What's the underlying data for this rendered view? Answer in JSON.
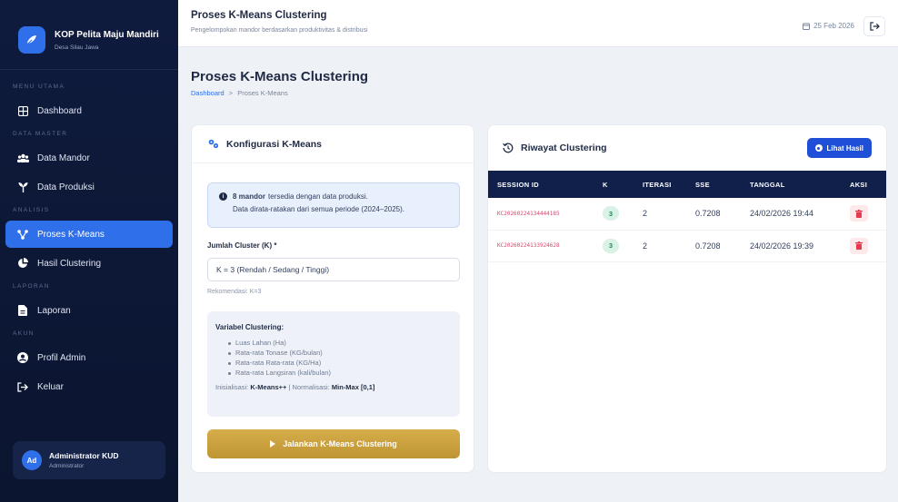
{
  "brand": {
    "title": "KOP Pelita Maju Mandiri",
    "subtitle": "Desa Silau Jawa"
  },
  "sidebar": {
    "sections": [
      {
        "label": "MENU UTAMA",
        "items": [
          {
            "label": "Dashboard",
            "icon": "grid-icon",
            "active": false
          }
        ]
      },
      {
        "label": "DATA MASTER",
        "items": [
          {
            "label": "Data Mandor",
            "icon": "users-icon",
            "active": false
          },
          {
            "label": "Data Produksi",
            "icon": "plant-icon",
            "active": false
          }
        ]
      },
      {
        "label": "ANALISIS",
        "items": [
          {
            "label": "Proses K-Means",
            "icon": "network-icon",
            "active": true
          },
          {
            "label": "Hasil Clustering",
            "icon": "pie-chart-icon",
            "active": false
          }
        ]
      },
      {
        "label": "LAPORAN",
        "items": [
          {
            "label": "Laporan",
            "icon": "file-icon",
            "active": false
          }
        ]
      },
      {
        "label": "AKUN",
        "items": [
          {
            "label": "Profil Admin",
            "icon": "user-circle-icon",
            "active": false
          },
          {
            "label": "Keluar",
            "icon": "logout-icon",
            "active": false
          }
        ]
      }
    ]
  },
  "user": {
    "name": "Administrator KUD",
    "role": "Administrator",
    "initials": "Ad"
  },
  "topbar": {
    "title": "Proses K-Means Clustering",
    "subtitle": "Pengelompokan mandor berdasarkan produktivitas & distribusi",
    "date": "25 Feb 2026"
  },
  "page": {
    "title": "Proses K-Means Clustering",
    "breadcrumb_root": "Dashboard",
    "breadcrumb_sep": ">",
    "breadcrumb_current": "Proses K-Means"
  },
  "config": {
    "title": "Konfigurasi K-Means",
    "info_count": "8 mandor",
    "info_text1": "tersedia dengan data produksi.",
    "info_text2": "Data dirata-ratakan dari semua periode (2024–2025).",
    "field_label": "Jumlah Cluster (K) *",
    "select_value": "K = 3 (Rendah / Sedang / Tinggi)",
    "recommendation": "Rekomendasi: K=3",
    "variables_title": "Variabel Clustering:",
    "variables": [
      "Luas Lahan (Ha)",
      "Rata-rata Tonase (KG/bulan)",
      "Rata-rata Rata-rata (KG/Ha)",
      "Rata-rata Langsiran (kali/bulan)"
    ],
    "init_label": "Inisialisasi:",
    "init_value": "K-Means++",
    "init_sep": "|",
    "norm_label": "Normalisasi:",
    "norm_value": "Min-Max [0,1]",
    "run_button": "Jalankan K-Means Clustering"
  },
  "history": {
    "title": "Riwayat Clustering",
    "view_button": "Lihat Hasil",
    "columns": [
      "SESSION ID",
      "K",
      "ITERASI",
      "SSE",
      "TANGGAL",
      "AKSI"
    ],
    "rows": [
      {
        "session_id": "KC20260224134444185",
        "k": "3",
        "iterasi": "2",
        "sse": "0.7208",
        "tanggal": "24/02/2026 19:44"
      },
      {
        "session_id": "KC20260224133924628",
        "k": "3",
        "iterasi": "2",
        "sse": "0.7208",
        "tanggal": "24/02/2026 19:39"
      }
    ]
  },
  "colors": {
    "sidebar_bg": "#0f1b3d",
    "accent": "#2f6fea",
    "gold": "#c9a03f",
    "table_head": "#10204a",
    "danger": "#e53950"
  }
}
